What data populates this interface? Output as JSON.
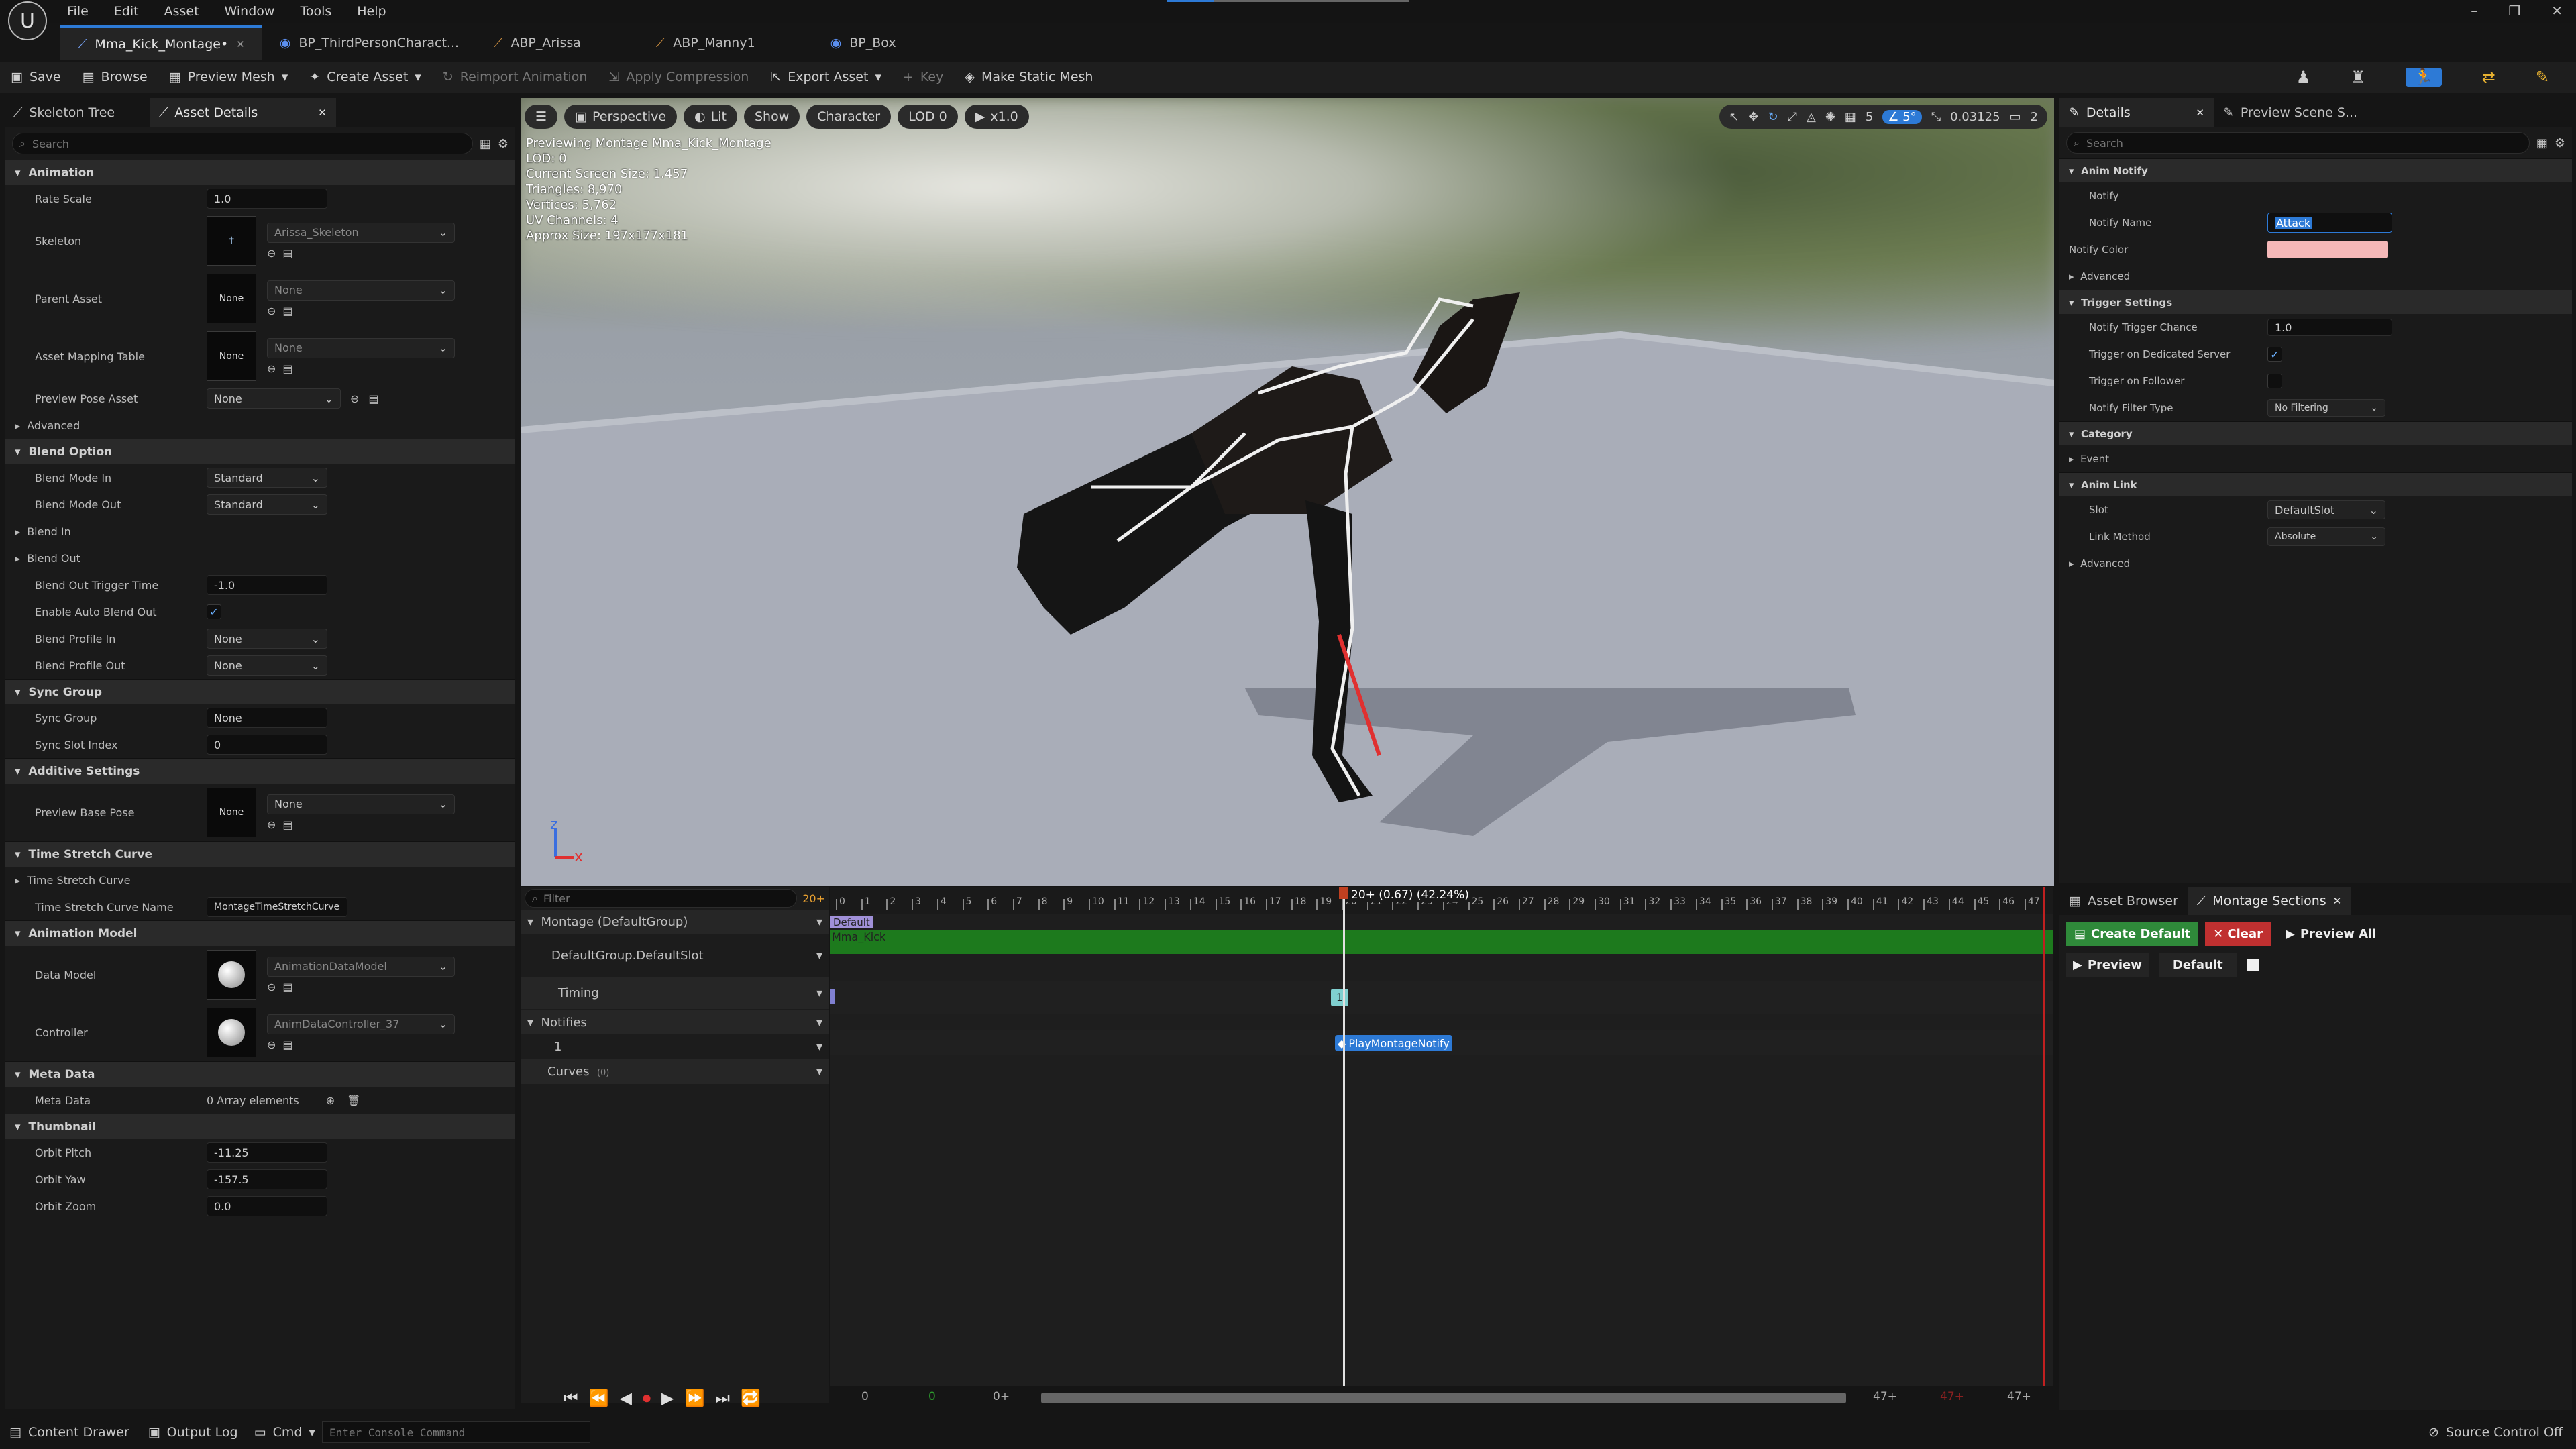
{
  "menu": [
    "File",
    "Edit",
    "Asset",
    "Window",
    "Tools",
    "Help"
  ],
  "doc_tabs": [
    {
      "label": "Mma_Kick_Montage•",
      "active": true
    },
    {
      "label": "BP_ThirdPersonCharact...",
      "active": false
    },
    {
      "label": "ABP_Arissa",
      "active": false
    },
    {
      "label": "ABP_Manny1",
      "active": false
    },
    {
      "label": "BP_Box",
      "active": false
    }
  ],
  "toolbar": {
    "save": "Save",
    "browse": "Browse",
    "preview_mesh": "Preview Mesh",
    "create_asset": "Create Asset",
    "reimport": "Reimport Animation",
    "apply_compression": "Apply Compression",
    "export_asset": "Export Asset",
    "key": "Key",
    "make_static_mesh": "Make Static Mesh"
  },
  "left": {
    "tab1": "Skeleton Tree",
    "tab2": "Asset Details",
    "search": "Search",
    "rate_scale_label": "Rate Scale",
    "rate_scale": "1.0",
    "skeleton_label": "Skeleton",
    "skeleton": "Arissa_Skeleton",
    "parent_asset_label": "Parent Asset",
    "parent_asset": "None",
    "none": "None",
    "asset_mapping_label": "Asset Mapping Table",
    "asset_mapping": "None",
    "preview_pose_label": "Preview Pose Asset",
    "preview_pose": "None",
    "advanced": "Advanced",
    "cat_animation": "Animation",
    "cat_blend": "Blend Option",
    "blend_mode_in_label": "Blend Mode In",
    "blend_mode_in": "Standard",
    "blend_mode_out_label": "Blend Mode Out",
    "blend_mode_out": "Standard",
    "blend_in": "Blend In",
    "blend_out": "Blend Out",
    "blend_out_trigger_label": "Blend Out Trigger Time",
    "blend_out_trigger": "-1.0",
    "enable_auto_label": "Enable Auto Blend Out",
    "blend_profile_in_label": "Blend Profile In",
    "blend_profile_in": "None",
    "blend_profile_out_label": "Blend Profile Out",
    "blend_profile_out": "None",
    "cat_sync": "Sync Group",
    "sync_group_label": "Sync Group",
    "sync_group": "None",
    "sync_slot_label": "Sync Slot Index",
    "sync_slot": "0",
    "cat_additive": "Additive Settings",
    "preview_base_pose_label": "Preview Base Pose",
    "preview_base_pose": "None",
    "cat_time_stretch": "Time Stretch Curve",
    "time_stretch_curve": "Time Stretch Curve",
    "time_stretch_name_label": "Time Stretch Curve Name",
    "time_stretch_name": "MontageTimeStretchCurve",
    "cat_anim_model": "Animation Model",
    "data_model_label": "Data Model",
    "data_model": "AnimationDataModel",
    "controller_label": "Controller",
    "controller": "AnimDataController_37",
    "cat_meta": "Meta Data",
    "meta_data_label": "Meta Data",
    "meta_data": "0 Array elements",
    "cat_thumbnail": "Thumbnail",
    "orbit_pitch_label": "Orbit Pitch",
    "orbit_pitch": "-11.25",
    "orbit_yaw_label": "Orbit Yaw",
    "orbit_yaw": "-157.5",
    "orbit_zoom_label": "Orbit Zoom",
    "orbit_zoom": "0.0"
  },
  "viewport": {
    "perspective": "Perspective",
    "lit": "Lit",
    "show": "Show",
    "character": "Character",
    "lod": "LOD 0",
    "speed": "x1.0",
    "grid_val": "5",
    "angle_val": "5°",
    "scale_val": "0.03125",
    "cam_val": "2",
    "info": [
      "Previewing Montage Mma_Kick_Montage",
      "LOD: 0",
      "Current Screen Size: 1.457",
      "Triangles: 8,970",
      "Vertices: 5,762",
      "UV Channels: 4",
      "Approx Size: 197x177x181"
    ]
  },
  "details": {
    "tab": "Details",
    "tab2": "Preview Scene S...",
    "search": "Search",
    "cat_anim_notify": "Anim Notify",
    "notify_label": "Notify",
    "notify_name_label": "Notify Name",
    "notify_name": "Attack",
    "notify_color_label": "Notify Color",
    "notify_color": "#f5b8b8",
    "advanced": "Advanced",
    "cat_trigger": "Trigger Settings",
    "trigger_chance_label": "Notify Trigger Chance",
    "trigger_chance": "1.0",
    "trigger_server_label": "Trigger on Dedicated Server",
    "trigger_follower_label": "Trigger on Follower",
    "filter_type_label": "Notify Filter Type",
    "filter_type": "No Filtering",
    "cat_category": "Category",
    "event": "Event",
    "cat_anim_link": "Anim Link",
    "slot_label": "Slot",
    "slot": "DefaultSlot",
    "link_method_label": "Link Method",
    "link_method": "Absolute",
    "advanced2": "Advanced"
  },
  "timeline": {
    "filter": "Filter",
    "frame_badge": "20+",
    "montage": "Montage (DefaultGroup)",
    "slot": "DefaultGroup.DefaultSlot",
    "timing": "Timing",
    "notifies": "Notifies",
    "notify_track": "1",
    "curves": "Curves",
    "curves_count": "(0)",
    "playhead": "20+ (0.67) (42.24%)",
    "section": "Default",
    "clip": "Mma_Kick",
    "timing_marker": "1",
    "notify_event": "PlayMontageNotify",
    "ticks": [
      "0",
      "1",
      "2",
      "3",
      "4",
      "5",
      "6",
      "7",
      "8",
      "9",
      "10",
      "11",
      "12",
      "13",
      "14",
      "15",
      "16",
      "17",
      "18",
      "19",
      "20",
      "21",
      "22",
      "23",
      "24",
      "25",
      "26",
      "27",
      "28",
      "29",
      "30",
      "31",
      "32",
      "33",
      "34",
      "35",
      "36",
      "37",
      "38",
      "39",
      "40",
      "41",
      "42",
      "43",
      "44",
      "45",
      "46",
      "47"
    ],
    "bottom": [
      "0",
      "0",
      "0+",
      "47+",
      "47+",
      "47+"
    ]
  },
  "sections": {
    "tab1": "Asset Browser",
    "tab2": "Montage Sections",
    "create_default": "Create Default",
    "clear": "Clear",
    "preview_all": "Preview All",
    "preview": "Preview",
    "default": "Default"
  },
  "status": {
    "content_drawer": "Content Drawer",
    "output_log": "Output Log",
    "cmd": "Cmd",
    "console_placeholder": "Enter Console Command",
    "source_control": "Source Control Off"
  }
}
